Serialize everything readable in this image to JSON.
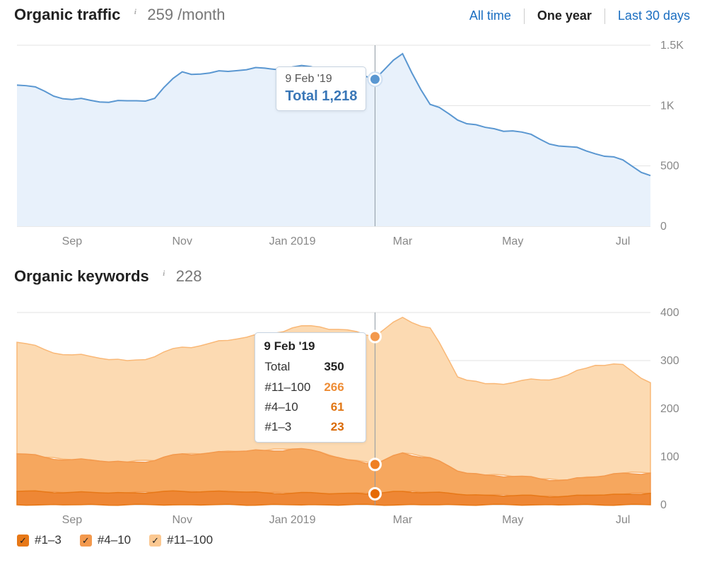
{
  "header": {
    "traffic_title": "Organic traffic",
    "traffic_value": "259 /month",
    "tabs": {
      "all": "All time",
      "year": "One year",
      "last30": "Last 30 days",
      "active": "year"
    },
    "keywords_title": "Organic keywords",
    "keywords_value": "228"
  },
  "traffic_tooltip": {
    "date": "9 Feb '19",
    "total_label": "Total",
    "total_value": "1,218"
  },
  "keywords_tooltip": {
    "date": "9 Feb '19",
    "rows": [
      {
        "label": "Total",
        "value": "350",
        "cls": "c-total"
      },
      {
        "label": "#11–100",
        "value": "266",
        "cls": "c-b1"
      },
      {
        "label": "#4–10",
        "value": "61",
        "cls": "c-b2"
      },
      {
        "label": "#1–3",
        "value": "23",
        "cls": "c-b3"
      }
    ]
  },
  "legend": {
    "a": "#1–3",
    "b": "#4–10",
    "c": "#11–100"
  },
  "chart_data": [
    {
      "type": "area",
      "title": "Organic traffic",
      "xlabel": "",
      "ylabel": "",
      "ylim": [
        0,
        1500
      ],
      "y_ticks": [
        "0",
        "500",
        "1K",
        "1.5K"
      ],
      "x_tick_labels": [
        "Sep",
        "Nov",
        "Jan 2019",
        "Mar",
        "May",
        "Jul"
      ],
      "x_tick_index": [
        2,
        6,
        10,
        14,
        18,
        22
      ],
      "x": [
        0,
        1,
        2,
        3,
        4,
        5,
        6,
        7,
        8,
        9,
        10,
        11,
        12,
        13,
        14,
        15,
        16,
        17,
        18,
        19,
        20,
        21,
        22,
        23
      ],
      "hover_index": 13,
      "hover_date": "9 Feb '19",
      "series": [
        {
          "name": "Organic traffic",
          "color": "#5a97d1",
          "fill": "#e8f1fb",
          "values": [
            1170,
            1120,
            1050,
            1030,
            1040,
            1060,
            1280,
            1270,
            1290,
            1310,
            1320,
            1300,
            1310,
            1218,
            1430,
            1010,
            880,
            820,
            790,
            720,
            660,
            600,
            550,
            420
          ]
        }
      ]
    },
    {
      "type": "area",
      "title": "Organic keywords",
      "xlabel": "",
      "ylabel": "",
      "ylim": [
        0,
        400
      ],
      "y_ticks": [
        "0",
        "100",
        "200",
        "300",
        "400"
      ],
      "x_tick_labels": [
        "Sep",
        "Nov",
        "Jan 2019",
        "Mar",
        "May",
        "Jul"
      ],
      "x_tick_index": [
        2,
        6,
        10,
        14,
        18,
        22
      ],
      "x": [
        0,
        1,
        2,
        3,
        4,
        5,
        6,
        7,
        8,
        9,
        10,
        11,
        12,
        13,
        14,
        15,
        16,
        17,
        18,
        19,
        20,
        21,
        22,
        23
      ],
      "hover_index": 13,
      "hover_date": "9 Feb '19",
      "series": [
        {
          "name": "#1–3",
          "color": "#e77817",
          "fill": "#ee8735",
          "values": [
            28,
            27,
            26,
            25,
            25,
            26,
            28,
            28,
            27,
            25,
            24,
            24,
            24,
            23,
            28,
            26,
            22,
            20,
            19,
            18,
            18,
            20,
            22,
            24
          ]
        },
        {
          "name": "#4–10",
          "color": "#f3994d",
          "fill": "#f6a75e",
          "values": [
            78,
            72,
            68,
            66,
            64,
            66,
            78,
            80,
            84,
            88,
            92,
            86,
            70,
            61,
            80,
            72,
            48,
            42,
            40,
            36,
            34,
            38,
            44,
            42
          ]
        },
        {
          "name": "#11–100",
          "color": "#f9b877",
          "fill": "#fcdab2",
          "values": [
            232,
            224,
            218,
            214,
            211,
            216,
            222,
            228,
            234,
            242,
            252,
            260,
            270,
            266,
            282,
            270,
            196,
            190,
            195,
            206,
            218,
            232,
            226,
            188
          ]
        }
      ],
      "stacked_total_at_hover": 350
    }
  ]
}
